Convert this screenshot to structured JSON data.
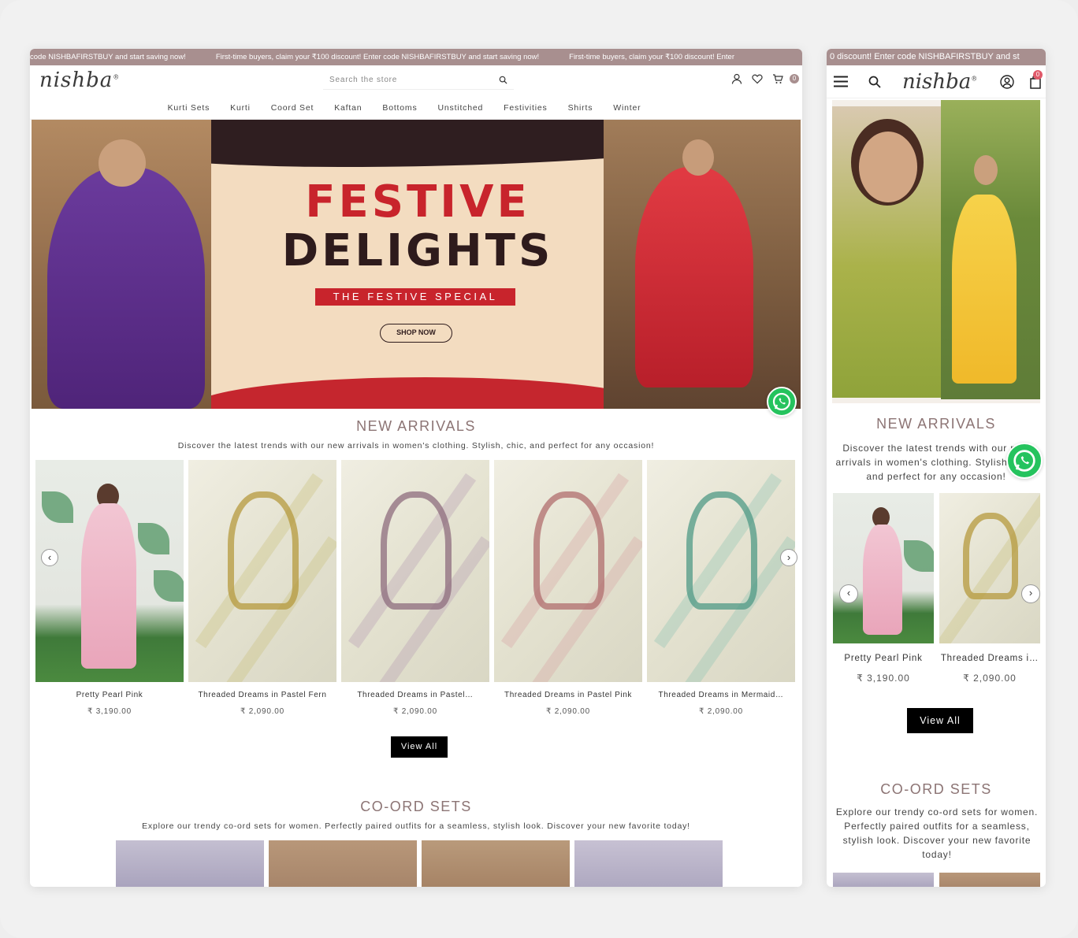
{
  "announcement": {
    "items": [
      "code NISHBAFIRSTBUY and start saving now!",
      "First-time buyers, claim your ₹100 discount! Enter code NISHBAFIRSTBUY and start saving now!",
      "First-time buyers, claim your ₹100 discount! Enter"
    ],
    "mobile_text": "0 discount! Enter code NISHBAFIRSTBUY and st"
  },
  "brand": {
    "logo_text": "nishba",
    "registered_mark": "®"
  },
  "search": {
    "placeholder": "Search the store"
  },
  "cart": {
    "count": "0",
    "mobile_count": "0"
  },
  "nav": {
    "items": [
      "Kurti Sets",
      "Kurti",
      "Coord Set",
      "Kaftan",
      "Bottoms",
      "Unstitched",
      "Festivities",
      "Shirts",
      "Winter"
    ]
  },
  "hero": {
    "line1": "FESTIVE",
    "line2": "DELIGHTS",
    "tagline": "THE FESTIVE SPECIAL",
    "cta": "SHOP NOW"
  },
  "new_arrivals": {
    "title": "NEW ARRIVALS",
    "subtitle": "Discover the latest trends with our new arrivals in women's clothing. Stylish, chic, and perfect for any occasion!",
    "mobile_subtitle": "Discover the latest trends with our new arrivals in women's clothing. Stylish, chic, and perfect for any occasion!",
    "products": [
      {
        "name": "Pretty Pearl Pink",
        "price": "₹ 3,190.00"
      },
      {
        "name": "Threaded Dreams in Pastel Fern",
        "price": "₹ 2,090.00"
      },
      {
        "name": "Threaded Dreams in Pastel…",
        "price": "₹ 2,090.00"
      },
      {
        "name": "Threaded Dreams in Pastel Pink",
        "price": "₹ 2,090.00"
      },
      {
        "name": "Threaded Dreams in Mermaid…",
        "price": "₹ 2,090.00"
      }
    ],
    "mobile_products": [
      {
        "name": "Pretty Pearl Pink",
        "price": "₹ 3,190.00"
      },
      {
        "name": "Threaded Dreams i…",
        "price": "₹ 2,090.00"
      }
    ],
    "view_all": "View All"
  },
  "coord": {
    "title": "CO-ORD SETS",
    "subtitle": "Explore our trendy co-ord sets for women. Perfectly paired outfits for a seamless, stylish look. Discover your new favorite today!"
  },
  "colors": {
    "accent": "#a88f8f",
    "festive_red": "#c8242c",
    "whatsapp": "#25c35e"
  },
  "icons": [
    "search-icon",
    "account-icon",
    "wishlist-heart-icon",
    "cart-icon",
    "menu-icon",
    "whatsapp-icon",
    "chevron-left-icon",
    "chevron-right-icon"
  ]
}
